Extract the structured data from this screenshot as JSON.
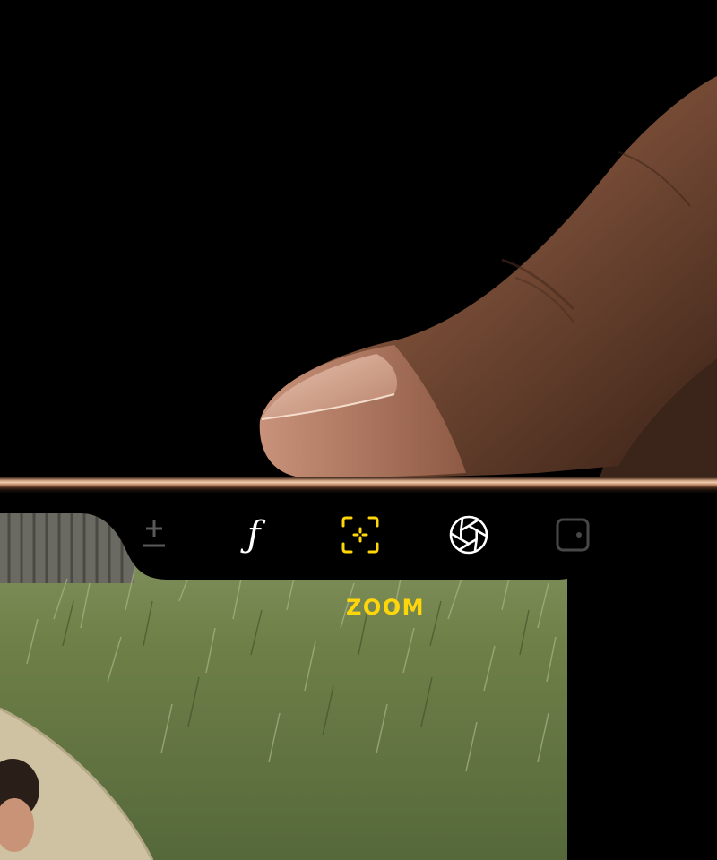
{
  "camera_controls": {
    "items": [
      {
        "id": "exposure",
        "icon": "exposure-icon",
        "state": "dimmed"
      },
      {
        "id": "aperture-f",
        "icon": "f-stop-icon",
        "glyph": "ƒ",
        "state": "normal"
      },
      {
        "id": "zoom",
        "icon": "zoom-focus-frame-icon",
        "state": "selected"
      },
      {
        "id": "aperture-ring",
        "icon": "aperture-icon",
        "state": "normal"
      },
      {
        "id": "extra",
        "icon": "square-control-icon",
        "state": "dimmed"
      }
    ],
    "selected_label": "ZOOM"
  },
  "colors": {
    "accent": "#ffd60a",
    "icon": "#ffffff",
    "bar_background": "#000000"
  }
}
